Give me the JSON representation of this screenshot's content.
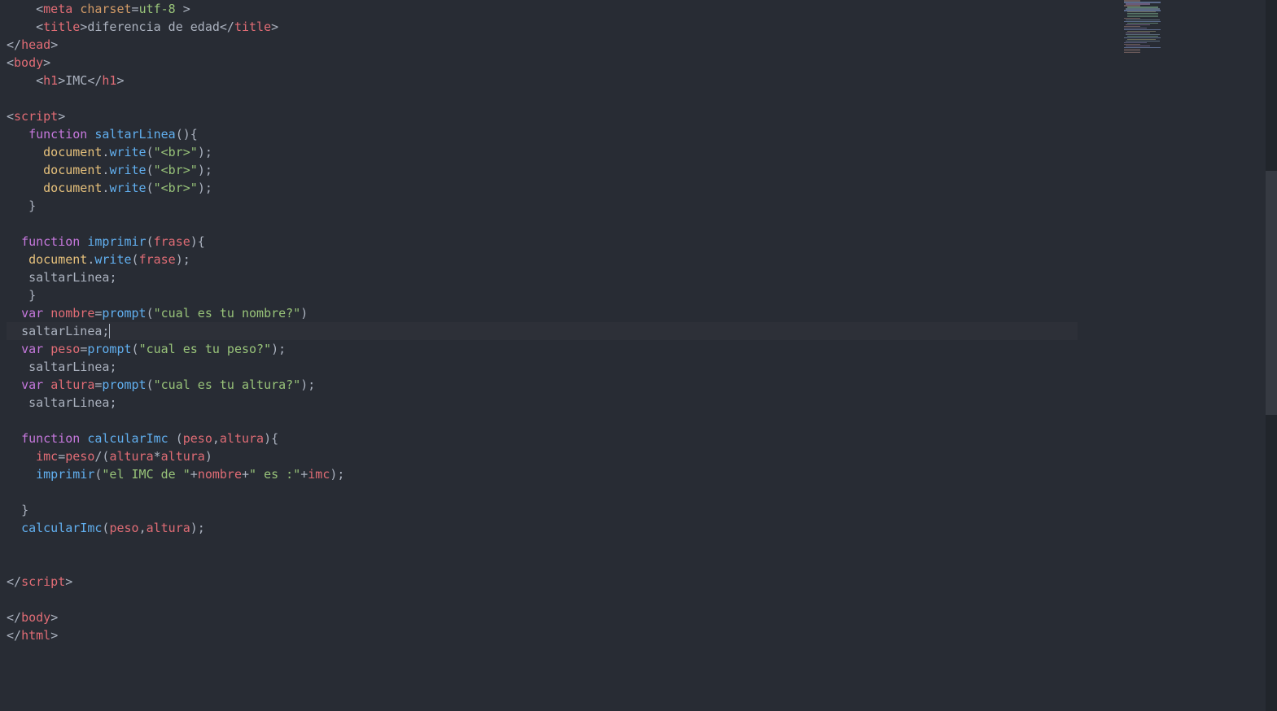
{
  "code": {
    "metaTag": "meta",
    "charsetAttr": "charset",
    "charsetVal": "utf-8",
    "titleTag": "title",
    "titleText": "diferencia de edad",
    "headTag": "head",
    "bodyTag": "body",
    "h1Tag": "h1",
    "h1Text": "IMC",
    "scriptTag": "script",
    "htmlTag": "html",
    "kwFunction": "function",
    "kwVar": "var",
    "fnSaltarLinea": "saltarLinea",
    "fnImprimir": "imprimir",
    "fnCalcularImc": "calcularImc",
    "objDocument": "document",
    "methWrite": "write",
    "strBr": "\"<br>\"",
    "paramFrase": "frase",
    "paramPeso": "peso",
    "paramAltura": "altura",
    "varNombre": "nombre",
    "varPeso": "peso",
    "varAltura": "altura",
    "varImc": "imc",
    "fnPrompt": "prompt",
    "strNombre": "\"cual es tu nombre?\"",
    "strPeso": "\"cual es tu peso?\"",
    "strAltura": "\"cual es tu altura?\"",
    "callSaltar": "saltarLinea",
    "strImc1": "\"el IMC de \"",
    "strImc2": "\" es :\"",
    "plusNombre": "nombre",
    "plusImc": "imc"
  }
}
